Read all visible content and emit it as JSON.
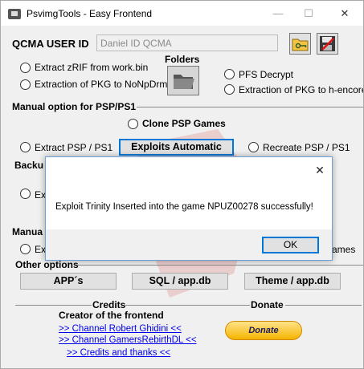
{
  "window": {
    "title": "PsvimgTools - Easy Frontend",
    "controls": {
      "minimize": "—",
      "maximize": "☐",
      "close": "✕"
    }
  },
  "qcma": {
    "label": "QCMA USER ID",
    "value": "Daniel ID QCMA"
  },
  "folders_label": "Folders",
  "options_top": {
    "extract_zrif": "Extract zRIF from work.bin",
    "extract_pkg_nonpdrm": "Extraction of PKG to NoNpDrm",
    "pfs_decrypt": "PFS Decrypt",
    "extract_pkg_hencore": "Extraction of PKG to h-encore"
  },
  "manual_psp": {
    "heading": "Manual option for PSP/PS1",
    "clone_games": "Clone PSP Games",
    "extract_psp_ps1": "Extract PSP / PS1",
    "exploits_button": "Exploits Automatic",
    "recreate_psp_ps1": "Recreate PSP / PS1"
  },
  "hidden_fragments": {
    "backup_heading": "Backu",
    "ex1": "Ex",
    "manual2": "Manua",
    "ex2": "Ex",
    "games": "ames"
  },
  "other_options": {
    "heading": "Other options",
    "apps_button": "APP´s",
    "sql_button": "SQL / app.db",
    "theme_button": "Theme / app.db"
  },
  "credits": {
    "heading": "Credits",
    "creator_label": "Creator of the frontend",
    "links": [
      ">> Channel Robert Ghidini <<",
      ">> Channel GamersRebirthDL <<",
      ">> Credits and thanks <<"
    ]
  },
  "donate": {
    "heading": "Donate",
    "button": "Donate"
  },
  "dialog": {
    "close": "✕",
    "message": "Exploit Trinity Inserted into the game NPUZ00278 successfully!",
    "ok": "OK"
  },
  "colors": {
    "accent": "#0078d7",
    "link": "#0000ee",
    "window_bg": "#f0f0f0"
  }
}
